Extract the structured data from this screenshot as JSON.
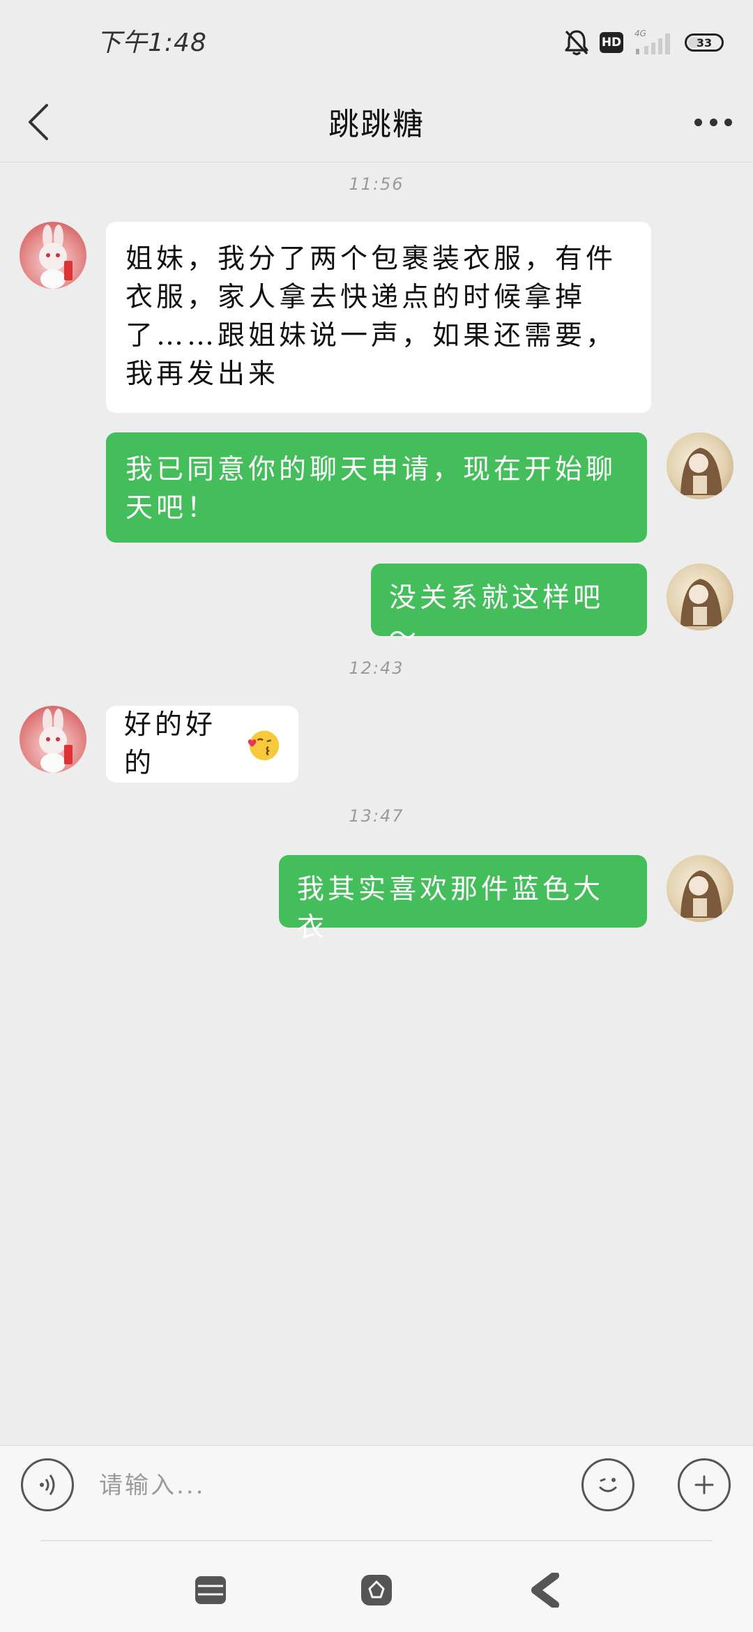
{
  "status_bar": {
    "time": "下午1:48",
    "hd_label": "HD",
    "network_label": "4G",
    "battery_level": "33",
    "icons": [
      "mute-icon",
      "hd-icon",
      "signal-icon",
      "battery-icon"
    ]
  },
  "header": {
    "title": "跳跳糖",
    "back_icon": "chevron-left-icon",
    "more_icon": "more-dots-icon"
  },
  "chat": {
    "timestamps": [
      "11:56",
      "12:43",
      "13:47"
    ],
    "messages": [
      {
        "sender": "contact",
        "text": "姐妹，我分了两个包裹装衣服，有件衣服，家人拿去快递点的时候拿掉了……跟姐妹说一声，如果还需要，我再发出来"
      },
      {
        "sender": "me",
        "text": "我已同意你的聊天申请，现在开始聊天吧！"
      },
      {
        "sender": "me",
        "text": "没关系就这样吧～"
      },
      {
        "sender": "contact",
        "text": "好的好的",
        "emoji": "kissing-face-emoji"
      },
      {
        "sender": "me",
        "text": "我其实喜欢那件蓝色大衣"
      }
    ]
  },
  "input_bar": {
    "placeholder": "请输入...",
    "voice_icon": "voice-icon",
    "emoji_icon": "smiley-icon",
    "plus_icon": "plus-icon"
  },
  "nav_bar": {
    "icons": [
      "menu-icon",
      "home-icon",
      "back-icon"
    ]
  },
  "colors": {
    "background": "#EDEDED",
    "outgoing_bubble": "#43BE5A",
    "incoming_bubble": "#FFFFFF",
    "text_dark": "#111111",
    "timestamp": "#9A9A9A"
  }
}
